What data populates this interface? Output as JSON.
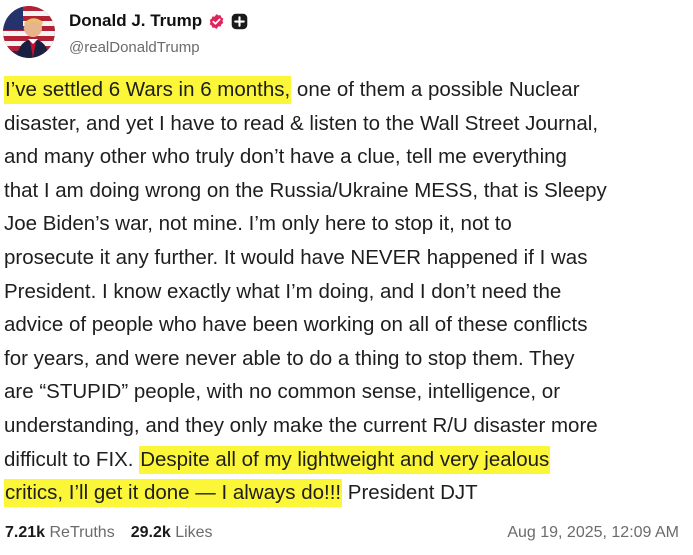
{
  "author": {
    "display_name": "Donald J. Trump",
    "handle": "@realDonaldTrump",
    "avatar_icon": "flag-portrait-avatar",
    "verified_icon": "verified-check-icon",
    "badge_icon": "plus-badge-icon",
    "verified_color": "#e0245e"
  },
  "post": {
    "highlight_color": "#fbf637",
    "lines": [
      {
        "hl": "I’ve settled 6 Wars in 6 months,",
        "text": " one of them a possible Nuclear"
      },
      {
        "hl": "",
        "text": "disaster, and yet I have to read & listen to the Wall Street Journal,"
      },
      {
        "hl": "",
        "text": "and many other who truly don’t have a clue, tell me everything"
      },
      {
        "hl": "",
        "text": "that I am doing wrong on the Russia/Ukraine MESS, that is Sleepy"
      },
      {
        "hl": "",
        "text": "Joe Biden’s war, not mine. I’m only here to stop it, not to"
      },
      {
        "hl": "",
        "text": "prosecute it any further. It would have NEVER happened if I was"
      },
      {
        "hl": "",
        "text": "President. I know exactly what I’m doing, and I don’t need the"
      },
      {
        "hl": "",
        "text": "advice of people who have been working on all of these conflicts"
      },
      {
        "hl": "",
        "text": "for years, and were never able to do a thing to stop them. They"
      },
      {
        "hl": "",
        "text": "are “STUPID” people, with no common sense, intelligence, or"
      },
      {
        "hl": "",
        "text": "understanding, and they only make the current R/U disaster more"
      },
      {
        "pre": "difficult to FIX. ",
        "hl": "Despite all of my lightweight and very jealous",
        "text": ""
      },
      {
        "hl": "critics, I’ll get it done — I always do!!!",
        "text": " President DJT"
      }
    ]
  },
  "footer": {
    "retruths_count": "7.21k",
    "retruths_label": "ReTruths",
    "likes_count": "29.2k",
    "likes_label": "Likes",
    "timestamp": "Aug 19, 2025, 12:09 AM"
  }
}
